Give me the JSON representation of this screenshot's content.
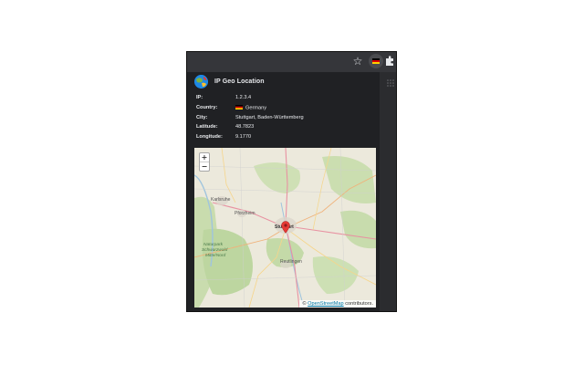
{
  "extension": {
    "title": "IP Geo Location",
    "logo_icon": "globe-logo-icon"
  },
  "toolbar": {
    "star_icon": "star-icon",
    "extension_icon": "flag-extension-icon",
    "puzzle_icon": "puzzle-icon"
  },
  "info": {
    "ip_label": "IP:",
    "ip_value": "1.2.3.4",
    "country_label": "Country:",
    "country_value": "Germany",
    "city_label": "City:",
    "city_value": "Stuttgart, Baden-Württemberg",
    "latitude_label": "Latitude:",
    "latitude_value": "48.7823",
    "longitude_label": "Longitude:",
    "longitude_value": "9.1770"
  },
  "map": {
    "zoom_in": "+",
    "zoom_out": "−",
    "attribution_prefix": "©",
    "attribution_link": "OpenStreetMap",
    "attribution_suffix": "contributors.",
    "labels": {
      "karlsruhe": "Karlsruhe",
      "pforzheim": "Pforzheim",
      "stuttgart": "Stuttgart",
      "naturpark_1": "Naturpark",
      "naturpark_2": "Schwarzwald",
      "naturpark_3": "Mitte/Nord",
      "reutlingen": "Reutlingen"
    }
  },
  "colors": {
    "popup_bg": "#202124",
    "toolbar_bg": "#35363a",
    "text": "#e8eaed",
    "map_bg": "#ebe8da",
    "marker": "#e53935",
    "link": "#0078a8"
  }
}
